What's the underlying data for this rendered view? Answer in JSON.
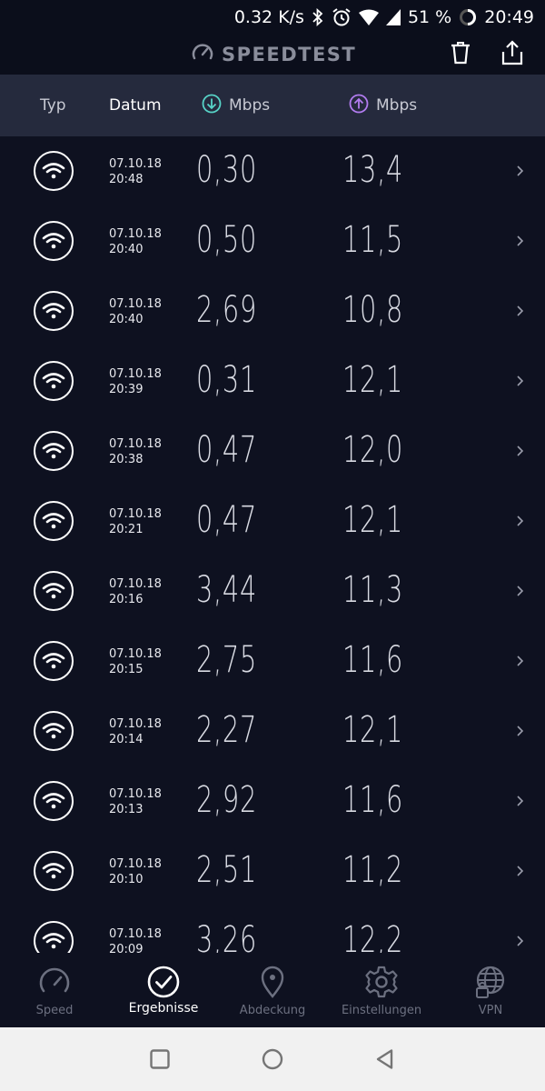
{
  "status_bar": {
    "speed": "0.32 K/s",
    "battery": "51 %",
    "time": "20:49"
  },
  "app_bar": {
    "title": "SPEEDTEST"
  },
  "table_header": {
    "type": "Typ",
    "date": "Datum",
    "download_unit": "Mbps",
    "upload_unit": "Mbps"
  },
  "results": [
    {
      "date": "07.10.18",
      "time": "20:48",
      "download": "0,30",
      "upload": "13,4"
    },
    {
      "date": "07.10.18",
      "time": "20:40",
      "download": "0,50",
      "upload": "11,5"
    },
    {
      "date": "07.10.18",
      "time": "20:40",
      "download": "2,69",
      "upload": "10,8"
    },
    {
      "date": "07.10.18",
      "time": "20:39",
      "download": "0,31",
      "upload": "12,1"
    },
    {
      "date": "07.10.18",
      "time": "20:38",
      "download": "0,47",
      "upload": "12,0"
    },
    {
      "date": "07.10.18",
      "time": "20:21",
      "download": "0,47",
      "upload": "12,1"
    },
    {
      "date": "07.10.18",
      "time": "20:16",
      "download": "3,44",
      "upload": "11,3"
    },
    {
      "date": "07.10.18",
      "time": "20:15",
      "download": "2,75",
      "upload": "11,6"
    },
    {
      "date": "07.10.18",
      "time": "20:14",
      "download": "2,27",
      "upload": "12,1"
    },
    {
      "date": "07.10.18",
      "time": "20:13",
      "download": "2,92",
      "upload": "11,6"
    },
    {
      "date": "07.10.18",
      "time": "20:10",
      "download": "2,51",
      "upload": "11,2"
    },
    {
      "date": "07.10.18",
      "time": "20:09",
      "download": "3,26",
      "upload": "12,2"
    }
  ],
  "bottom_nav": [
    {
      "label": "Speed",
      "icon": "gauge-icon",
      "active": false
    },
    {
      "label": "Ergebnisse",
      "icon": "check-circle-icon",
      "active": true
    },
    {
      "label": "Abdeckung",
      "icon": "location-pin-icon",
      "active": false
    },
    {
      "label": "Einstellungen",
      "icon": "gear-icon",
      "active": false
    },
    {
      "label": "VPN",
      "icon": "globe-lock-icon",
      "active": false
    }
  ],
  "colors": {
    "background": "#0e1120",
    "header_bg": "#252a3d",
    "download_accent": "#57d3c7",
    "upload_accent": "#b27cf0",
    "inactive_text": "#6c7080"
  }
}
